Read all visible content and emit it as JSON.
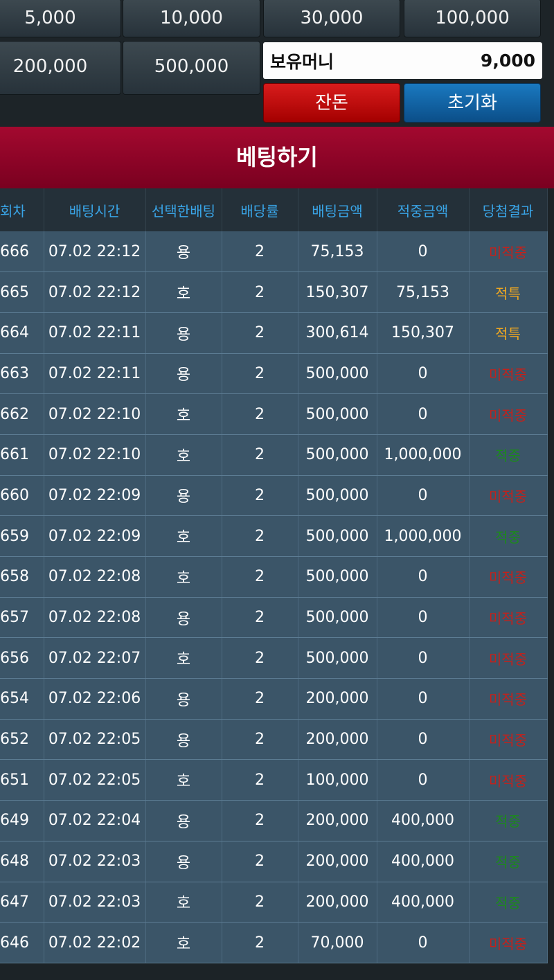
{
  "chips": [
    "5,000",
    "10,000",
    "30,000",
    "100,000",
    "200,000",
    "500,000"
  ],
  "balance": {
    "label": "보유머니",
    "value": "9,000"
  },
  "buttons": {
    "change": "잔돈",
    "reset": "초기화"
  },
  "bet_title": "베팅하기",
  "table": {
    "headers": [
      "회차",
      "배팅시간",
      "선택한배팅",
      "배당률",
      "배팅금액",
      "적중금액",
      "당첨결과"
    ],
    "rows": [
      [
        "666",
        "07.02 22:12",
        "용",
        "2",
        "75,153",
        "0",
        "미적중"
      ],
      [
        "665",
        "07.02 22:12",
        "호",
        "2",
        "150,307",
        "75,153",
        "적특"
      ],
      [
        "664",
        "07.02 22:11",
        "용",
        "2",
        "300,614",
        "150,307",
        "적특"
      ],
      [
        "663",
        "07.02 22:11",
        "용",
        "2",
        "500,000",
        "0",
        "미적중"
      ],
      [
        "662",
        "07.02 22:10",
        "호",
        "2",
        "500,000",
        "0",
        "미적중"
      ],
      [
        "661",
        "07.02 22:10",
        "호",
        "2",
        "500,000",
        "1,000,000",
        "적중"
      ],
      [
        "660",
        "07.02 22:09",
        "용",
        "2",
        "500,000",
        "0",
        "미적중"
      ],
      [
        "659",
        "07.02 22:09",
        "호",
        "2",
        "500,000",
        "1,000,000",
        "적중"
      ],
      [
        "658",
        "07.02 22:08",
        "호",
        "2",
        "500,000",
        "0",
        "미적중"
      ],
      [
        "657",
        "07.02 22:08",
        "용",
        "2",
        "500,000",
        "0",
        "미적중"
      ],
      [
        "656",
        "07.02 22:07",
        "호",
        "2",
        "500,000",
        "0",
        "미적중"
      ],
      [
        "654",
        "07.02 22:06",
        "용",
        "2",
        "200,000",
        "0",
        "미적중"
      ],
      [
        "652",
        "07.02 22:05",
        "용",
        "2",
        "200,000",
        "0",
        "미적중"
      ],
      [
        "651",
        "07.02 22:05",
        "호",
        "2",
        "100,000",
        "0",
        "미적중"
      ],
      [
        "649",
        "07.02 22:04",
        "용",
        "2",
        "200,000",
        "400,000",
        "적중"
      ],
      [
        "648",
        "07.02 22:03",
        "용",
        "2",
        "200,000",
        "400,000",
        "적중"
      ],
      [
        "647",
        "07.02 22:03",
        "호",
        "2",
        "200,000",
        "400,000",
        "적중"
      ],
      [
        "646",
        "07.02 22:02",
        "호",
        "2",
        "70,000",
        "0",
        "미적중"
      ]
    ]
  },
  "colors": {
    "miss": "#c4211b",
    "partial": "#f0a820",
    "hit": "#1c8a1c",
    "header_text": "#39a4e6"
  }
}
